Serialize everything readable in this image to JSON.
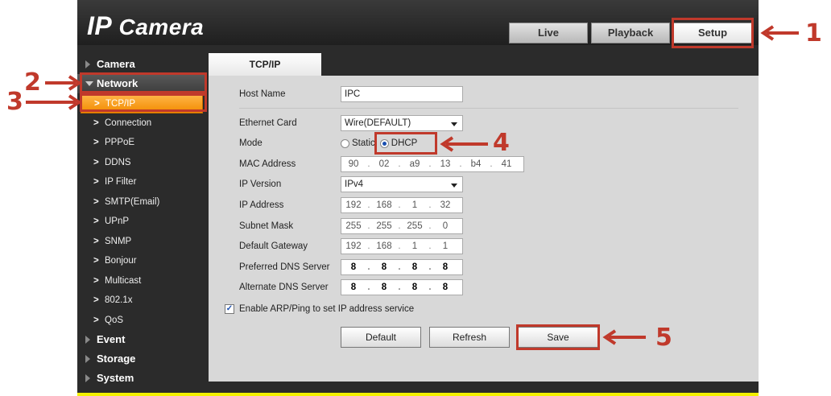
{
  "header": {
    "logo_prefix": "IP",
    "logo_suffix": "Camera",
    "tabs": [
      {
        "label": "Live"
      },
      {
        "label": "Playback"
      },
      {
        "label": "Setup"
      }
    ]
  },
  "sidebar": {
    "categories": {
      "camera": "Camera",
      "network": "Network",
      "event": "Event",
      "storage": "Storage",
      "system": "System"
    },
    "network_items": [
      "TCP/IP",
      "Connection",
      "PPPoE",
      "DDNS",
      "IP Filter",
      "SMTP(Email)",
      "UPnP",
      "SNMP",
      "Bonjour",
      "Multicast",
      "802.1x",
      "QoS"
    ],
    "chevron": ">"
  },
  "content": {
    "tab_title": "TCP/IP",
    "fields": {
      "host_name": {
        "label": "Host Name",
        "value": "IPC"
      },
      "ethernet_card": {
        "label": "Ethernet Card",
        "value": "Wire(DEFAULT)"
      },
      "mode": {
        "label": "Mode",
        "options": [
          "Static",
          "DHCP"
        ],
        "selected": "DHCP"
      },
      "mac_address": {
        "label": "MAC Address",
        "octets": [
          "90",
          "02",
          "a9",
          "13",
          "b4",
          "41"
        ]
      },
      "ip_version": {
        "label": "IP Version",
        "value": "IPv4"
      },
      "ip_address": {
        "label": "IP Address",
        "octets": [
          "192",
          "168",
          "1",
          "32"
        ]
      },
      "subnet_mask": {
        "label": "Subnet Mask",
        "octets": [
          "255",
          "255",
          "255",
          "0"
        ]
      },
      "default_gateway": {
        "label": "Default Gateway",
        "octets": [
          "192",
          "168",
          "1",
          "1"
        ]
      },
      "preferred_dns": {
        "label": "Preferred DNS Server",
        "octets": [
          "8",
          "8",
          "8",
          "8"
        ]
      },
      "alternate_dns": {
        "label": "Alternate DNS Server",
        "octets": [
          "8",
          "8",
          "8",
          "8"
        ]
      }
    },
    "arp_checkbox": {
      "label": "Enable ARP/Ping to set IP address service",
      "checked": true,
      "mark": "✓"
    },
    "buttons": {
      "default": "Default",
      "refresh": "Refresh",
      "save": "Save"
    }
  },
  "annotations": [
    "1",
    "2",
    "3",
    "4",
    "5"
  ],
  "colors": {
    "annotation": "#c0392b",
    "active_item": "#f28b00"
  }
}
